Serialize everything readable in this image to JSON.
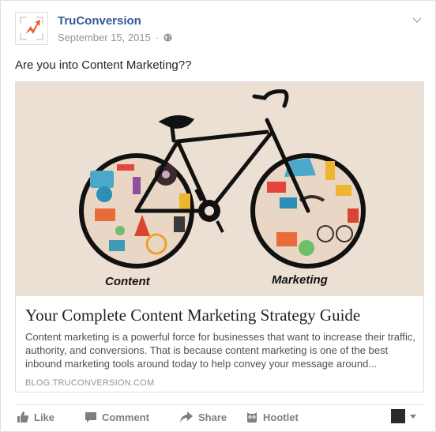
{
  "post": {
    "page_name": "TruConversion",
    "date": "September 15, 2015",
    "audience_icon": "globe-icon",
    "menu_icon": "chevron-down-icon",
    "message": "Are you into Content Marketing??"
  },
  "card": {
    "image_labels": {
      "left": "Content",
      "right": "Marketing"
    },
    "title": "Your Complete Content Marketing Strategy Guide",
    "description": "Content marketing is a powerful force for businesses that want to increase their traffic, authority, and conversions. That is because content marketing is one of the best inbound marketing tools around today to help convey your message around...",
    "domain": "BLOG.TRUCONVERSION.COM"
  },
  "actions": {
    "like": "Like",
    "comment": "Comment",
    "share": "Share",
    "hootlet": "Hootlet"
  },
  "colors": {
    "link": "#365899",
    "meta": "#90949c",
    "brand_orange": "#f05a28",
    "image_bg": "#ecdfd3"
  }
}
